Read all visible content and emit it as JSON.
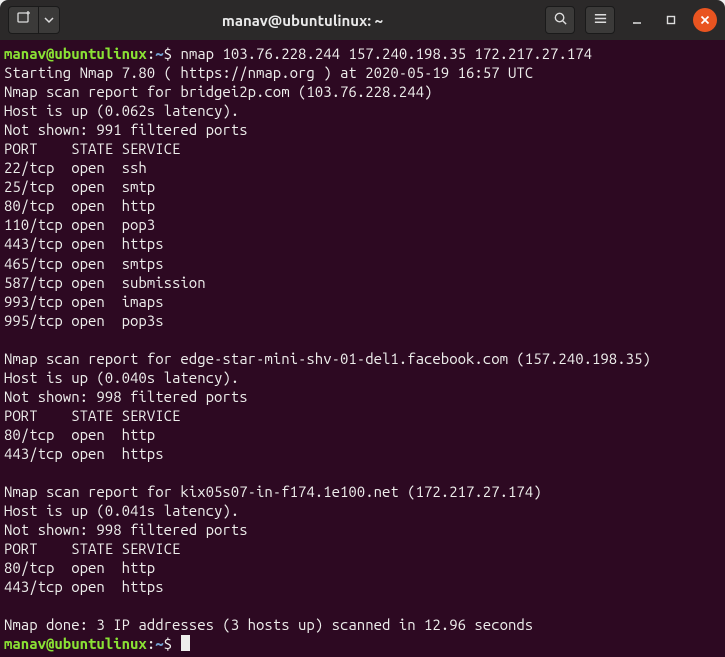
{
  "titlebar": {
    "title": "manav@ubuntulinux: ~",
    "new_tab_icon": "new-tab-icon",
    "dropdown_icon": "chevron-down-icon",
    "search_icon": "search-icon",
    "menu_icon": "hamburger-icon",
    "minimize": "−",
    "maximize": "□",
    "close": "×"
  },
  "prompt": {
    "userhost": "manav@ubuntulinux",
    "sep": ":",
    "path": "~",
    "end": "$"
  },
  "command": "nmap 103.76.228.244 157.240.198.35 172.217.27.174",
  "output": {
    "l1": "Starting Nmap 7.80 ( https://nmap.org ) at 2020-05-19 16:57 UTC",
    "host1": {
      "report": "Nmap scan report for bridgei2p.com (103.76.228.244)",
      "up": "Host is up (0.062s latency).",
      "notshown": "Not shown: 991 filtered ports",
      "header": "PORT    STATE SERVICE",
      "ports": [
        "22/tcp  open  ssh",
        "25/tcp  open  smtp",
        "80/tcp  open  http",
        "110/tcp open  pop3",
        "443/tcp open  https",
        "465/tcp open  smtps",
        "587/tcp open  submission",
        "993/tcp open  imaps",
        "995/tcp open  pop3s"
      ]
    },
    "host2": {
      "report": "Nmap scan report for edge-star-mini-shv-01-del1.facebook.com (157.240.198.35)",
      "up": "Host is up (0.040s latency).",
      "notshown": "Not shown: 998 filtered ports",
      "header": "PORT    STATE SERVICE",
      "ports": [
        "80/tcp  open  http",
        "443/tcp open  https"
      ]
    },
    "host3": {
      "report": "Nmap scan report for kix05s07-in-f174.1e100.net (172.217.27.174)",
      "up": "Host is up (0.041s latency).",
      "notshown": "Not shown: 998 filtered ports",
      "header": "PORT    STATE SERVICE",
      "ports": [
        "80/tcp  open  http",
        "443/tcp open  https"
      ]
    },
    "done": "Nmap done: 3 IP addresses (3 hosts up) scanned in 12.96 seconds"
  }
}
